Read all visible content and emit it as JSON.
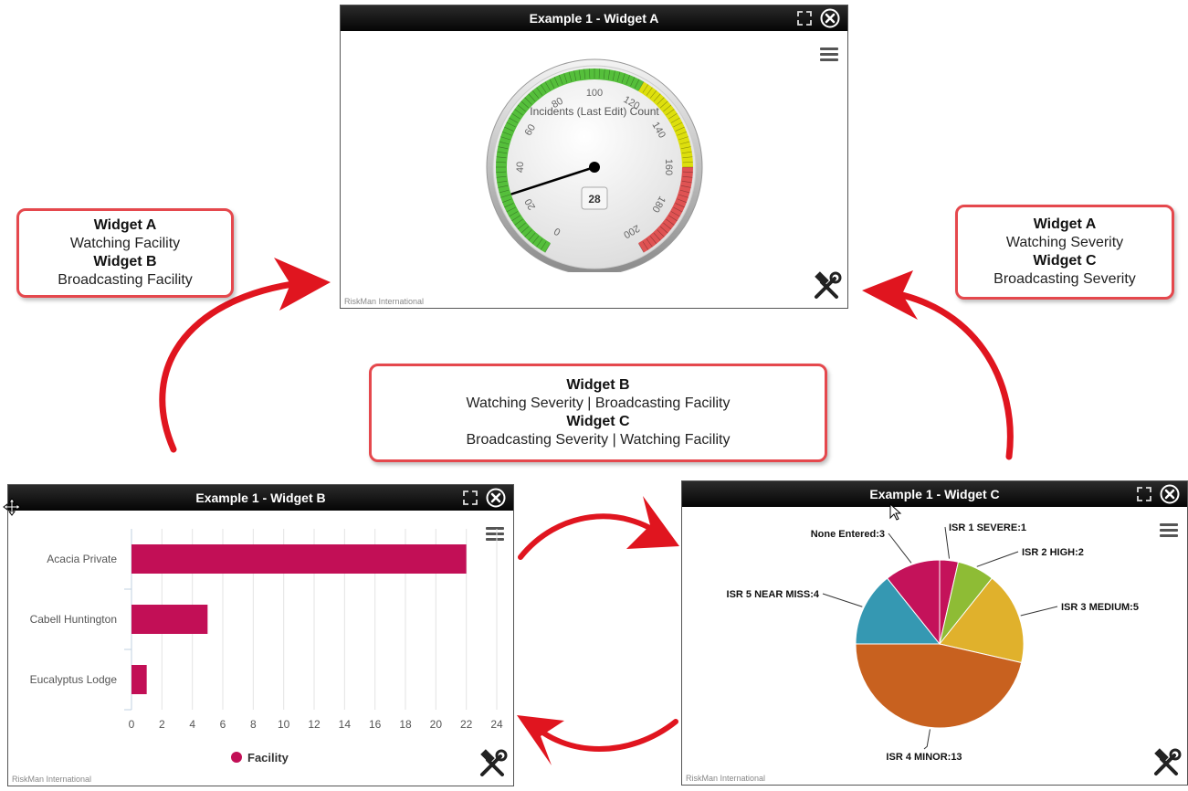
{
  "widget_a": {
    "title": "Example 1 - Widget A",
    "footer": "RiskMan International",
    "gauge": {
      "label": "Incidents (Last Edit) Count",
      "min": 0,
      "max": 200,
      "value": 28,
      "ticks": [
        "0",
        "20",
        "40",
        "60",
        "80",
        "100",
        "120",
        "140",
        "160",
        "180",
        "200"
      ],
      "bands": [
        {
          "from": 0,
          "to": 120,
          "color": "#55bf3b"
        },
        {
          "from": 120,
          "to": 160,
          "color": "#dddf0d"
        },
        {
          "from": 160,
          "to": 200,
          "color": "#df5353"
        }
      ]
    }
  },
  "widget_b": {
    "title": "Example 1 - Widget B",
    "footer": "RiskMan International",
    "legend": "Facility",
    "x_ticks": [
      "0",
      "2",
      "4",
      "6",
      "8",
      "10",
      "12",
      "14",
      "16",
      "18",
      "20",
      "22",
      "24"
    ]
  },
  "widget_c": {
    "title": "Example 1 - Widget C",
    "footer": "RiskMan International"
  },
  "callouts": {
    "left": {
      "l1": "Widget A",
      "l2": "Watching Facility",
      "l3": "Widget B",
      "l4": "Broadcasting Facility"
    },
    "right": {
      "l1": "Widget A",
      "l2": "Watching Severity",
      "l3": "Widget C",
      "l4": "Broadcasting Severity"
    },
    "middle": {
      "l1": "Widget B",
      "l2": "Watching Severity | Broadcasting Facility",
      "l3": "Widget C",
      "l4": "Broadcasting Severity | Watching Facility"
    }
  },
  "colors": {
    "bar": "#c20f56",
    "arrow": "#e0151f",
    "callout_border": "#e5484d"
  },
  "chart_data": [
    {
      "type": "bar",
      "orientation": "horizontal",
      "categories": [
        "Acacia Private",
        "Cabell Huntington",
        "Eucalyptus Lodge"
      ],
      "series": [
        {
          "name": "Facility",
          "values": [
            22,
            5,
            1
          ]
        }
      ],
      "xlim": [
        0,
        24
      ],
      "legend": "bottom"
    },
    {
      "type": "pie",
      "labels": [
        "ISR 1 SEVERE:1",
        "ISR 2 HIGH:2",
        "ISR 3 MEDIUM:5",
        "ISR 4 MINOR:13",
        "ISR 5 NEAR MISS:4",
        "None Entered:3"
      ],
      "values": [
        1,
        2,
        5,
        13,
        4,
        3
      ],
      "colors": [
        "#c4125a",
        "#8ebc35",
        "#e0b12c",
        "#c8611f",
        "#3598b2",
        "#c4125a"
      ]
    }
  ]
}
